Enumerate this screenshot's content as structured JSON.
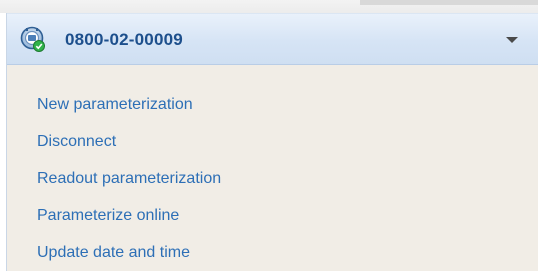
{
  "panel": {
    "device_id": "0800-02-00009",
    "device_icon": "connected-device-icon",
    "expand_icon": "chevron-down-icon",
    "colors": {
      "header_bg": "#d6e4f5",
      "body_bg": "#f1ede6",
      "title_text": "#1d4f8c",
      "link_text": "#2d6fb6",
      "status_green": "#2fb34a"
    }
  },
  "menu": {
    "items": [
      {
        "label": "New parameterization"
      },
      {
        "label": "Disconnect"
      },
      {
        "label": "Readout parameterization"
      },
      {
        "label": "Parameterize online"
      },
      {
        "label": "Update date and time"
      }
    ]
  }
}
